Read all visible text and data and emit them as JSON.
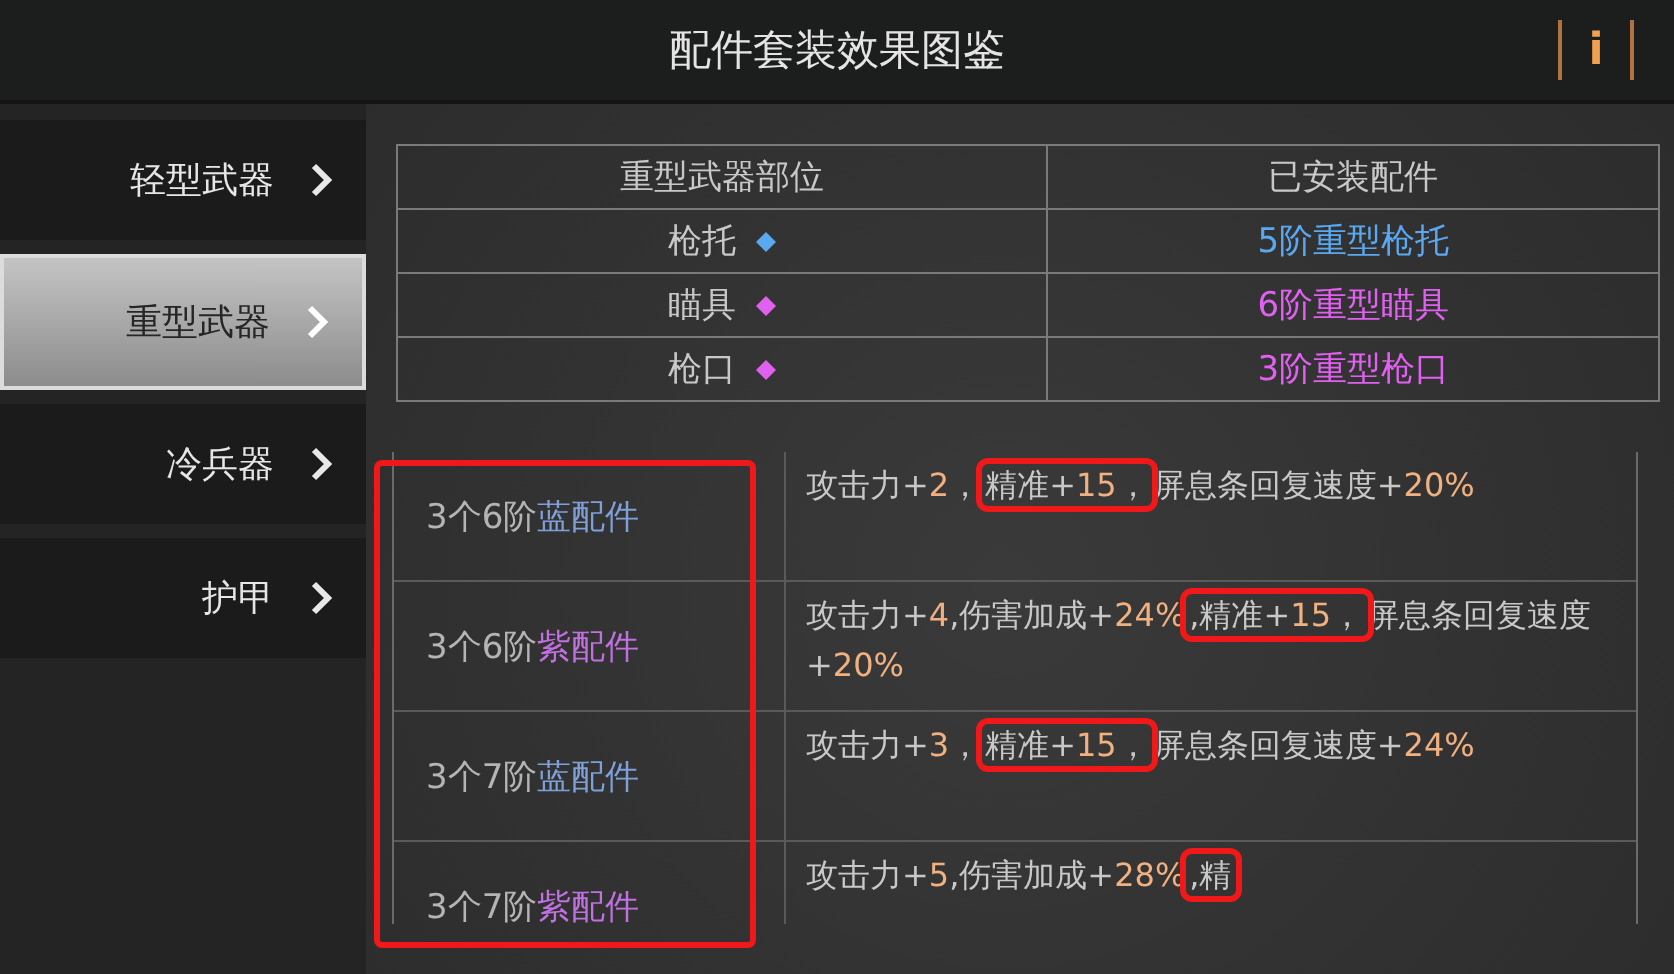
{
  "header": {
    "title": "配件套装效果图鉴",
    "info_button": "i"
  },
  "sidebar": {
    "items": [
      {
        "label": "轻型武器",
        "selected": false
      },
      {
        "label": "重型武器",
        "selected": true
      },
      {
        "label": "冷兵器",
        "selected": false
      },
      {
        "label": "护甲",
        "selected": false
      }
    ]
  },
  "parts_table": {
    "columns": [
      "重型武器部位",
      "已安装配件"
    ],
    "rows": [
      {
        "part": "枪托",
        "color": "#5aa8f0",
        "installed": "5阶重型枪托"
      },
      {
        "part": "瞄具",
        "color": "#e060f0",
        "installed": "6阶重型瞄具"
      },
      {
        "part": "枪口",
        "color": "#e060f0",
        "installed": "3阶重型枪口"
      }
    ]
  },
  "sets": {
    "name_column_marked": true,
    "rows": [
      {
        "name": [
          {
            "text": "3个6阶",
            "color": "#b4b4b4"
          },
          {
            "text": "蓝配件",
            "color": "#7f9fd8"
          }
        ],
        "effect": [
          {
            "text": "攻击力+",
            "kind": "plain",
            "boxed": false
          },
          {
            "text": "2",
            "kind": "value",
            "boxed": false
          },
          {
            "text": "，",
            "kind": "plain",
            "boxed": false
          },
          {
            "text": "精准+",
            "kind": "plain",
            "boxed": true
          },
          {
            "text": "15",
            "kind": "value",
            "boxed": true
          },
          {
            "text": "，",
            "kind": "plain",
            "boxed": true
          },
          {
            "text": "屏息条回复速度+",
            "kind": "plain",
            "boxed": false
          },
          {
            "text": "20%",
            "kind": "value",
            "boxed": false
          }
        ]
      },
      {
        "name": [
          {
            "text": "3个6阶",
            "color": "#b4b4b4"
          },
          {
            "text": "紫配件",
            "color": "#c070e0"
          }
        ],
        "effect": [
          {
            "text": "攻击力+",
            "kind": "plain",
            "boxed": false
          },
          {
            "text": "4",
            "kind": "value",
            "boxed": false
          },
          {
            "text": ",伤害加成+",
            "kind": "plain",
            "boxed": false
          },
          {
            "text": "24%",
            "kind": "value",
            "boxed": false
          },
          {
            "text": ",精准+",
            "kind": "plain",
            "boxed": true
          },
          {
            "text": "15",
            "kind": "value",
            "boxed": true
          },
          {
            "text": "，",
            "kind": "plain",
            "boxed": true
          },
          {
            "text": "屏息条回复速度+",
            "kind": "plain",
            "boxed": false
          },
          {
            "text": "20%",
            "kind": "value",
            "boxed": false
          }
        ]
      },
      {
        "name": [
          {
            "text": "3个7阶",
            "color": "#b4b4b4"
          },
          {
            "text": "蓝配件",
            "color": "#7f9fd8"
          }
        ],
        "effect": [
          {
            "text": "攻击力+",
            "kind": "plain",
            "boxed": false
          },
          {
            "text": "3",
            "kind": "value",
            "boxed": false
          },
          {
            "text": "，",
            "kind": "plain",
            "boxed": false
          },
          {
            "text": "精准+",
            "kind": "plain",
            "boxed": true
          },
          {
            "text": "15",
            "kind": "value",
            "boxed": true
          },
          {
            "text": "，",
            "kind": "plain",
            "boxed": true
          },
          {
            "text": "屏息条回复速度+",
            "kind": "plain",
            "boxed": false
          },
          {
            "text": "24%",
            "kind": "value",
            "boxed": false
          }
        ]
      },
      {
        "name": [
          {
            "text": "3个7阶",
            "color": "#b4b4b4"
          },
          {
            "text": "紫配件",
            "color": "#c070e0"
          }
        ],
        "effect": [
          {
            "text": "攻击力+",
            "kind": "plain",
            "boxed": false
          },
          {
            "text": "5",
            "kind": "value",
            "boxed": false
          },
          {
            "text": ",伤害加成+",
            "kind": "plain",
            "boxed": false
          },
          {
            "text": "28%",
            "kind": "value",
            "boxed": false
          },
          {
            "text": ",精",
            "kind": "plain",
            "boxed": true
          }
        ]
      }
    ]
  }
}
